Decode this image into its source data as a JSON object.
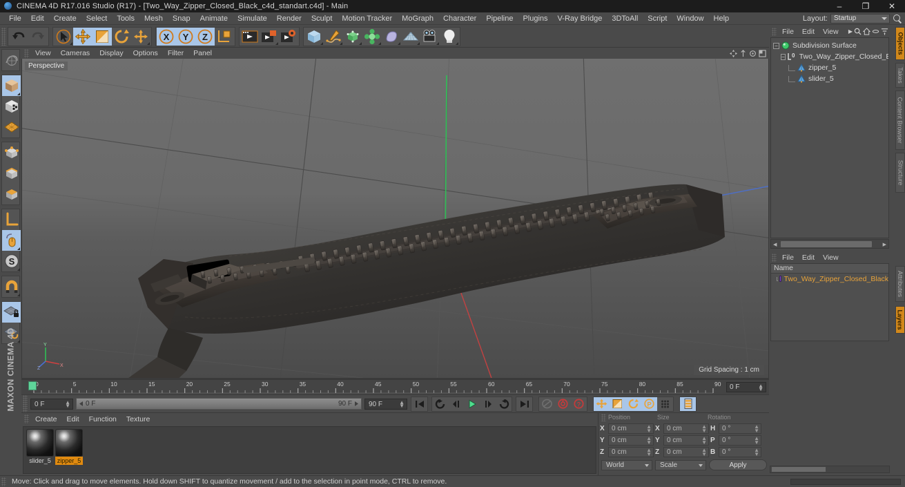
{
  "window": {
    "title": "CINEMA 4D R17.016 Studio (R17) - [Two_Way_Zipper_Closed_Black_c4d_standart.c4d] - Main",
    "minimize": "–",
    "maximize": "❐",
    "close": "✕"
  },
  "menubar": {
    "items": [
      "File",
      "Edit",
      "Create",
      "Select",
      "Tools",
      "Mesh",
      "Snap",
      "Animate",
      "Simulate",
      "Render",
      "Sculpt",
      "Motion Tracker",
      "MoGraph",
      "Character",
      "Pipeline",
      "Plugins",
      "V-Ray Bridge",
      "3DToAll",
      "Script",
      "Window",
      "Help"
    ],
    "layout_label": "Layout:",
    "layout_value": "Startup",
    "search_icon": "search-icon"
  },
  "toolbar": {
    "groups": [
      {
        "name": "history",
        "buttons": [
          {
            "icon": "undo-icon",
            "label": "Undo",
            "active": false
          },
          {
            "icon": "redo-icon",
            "label": "Redo",
            "active": false
          }
        ]
      },
      {
        "name": "selection-transform",
        "buttons": [
          {
            "icon": "live-selection-icon",
            "label": "Live Selection",
            "active": false
          },
          {
            "icon": "move-icon",
            "label": "Move",
            "active": true
          },
          {
            "icon": "scale-icon",
            "label": "Scale",
            "active": false
          },
          {
            "icon": "rotate-icon",
            "label": "Rotate",
            "active": false
          },
          {
            "icon": "move-alt-icon",
            "label": "Move (alt)",
            "active": false
          }
        ]
      },
      {
        "name": "axis-locks",
        "buttons": [
          {
            "icon": "axis-x-icon",
            "label": "X",
            "active": true
          },
          {
            "icon": "axis-y-icon",
            "label": "Y",
            "active": true
          },
          {
            "icon": "axis-z-icon",
            "label": "Z",
            "active": true
          },
          {
            "icon": "world-coordinate-icon",
            "label": "World/Object",
            "active": false
          }
        ]
      },
      {
        "name": "render",
        "buttons": [
          {
            "icon": "render-view-icon",
            "label": "Render View",
            "active": false
          },
          {
            "icon": "render-picture-viewer-icon",
            "label": "Render to Picture Viewer",
            "active": false
          },
          {
            "icon": "render-settings-icon",
            "label": "Edit Render Settings",
            "active": false
          }
        ]
      },
      {
        "name": "objects",
        "buttons": [
          {
            "icon": "cube-primitive-icon",
            "label": "Add Cube Object",
            "active": false
          },
          {
            "icon": "spline-pen-icon",
            "label": "Add Spline",
            "active": false
          },
          {
            "icon": "generator-nurbs-icon",
            "label": "Add NURBS Object",
            "active": false
          },
          {
            "icon": "mograph-cloner-icon",
            "label": "MoGraph",
            "active": false
          },
          {
            "icon": "deformer-icon",
            "label": "Add Deformer",
            "active": false
          },
          {
            "icon": "environment-floor-icon",
            "label": "Add Scene Object",
            "active": false
          },
          {
            "icon": "camera-icon",
            "label": "Add Camera",
            "active": false
          },
          {
            "icon": "light-icon",
            "label": "Add Light",
            "active": false
          }
        ]
      }
    ]
  },
  "leftbar": {
    "groups": [
      {
        "buttons": [
          {
            "icon": "make-editable-icon",
            "label": "Make Editable",
            "active": false
          }
        ]
      },
      {
        "buttons": [
          {
            "icon": "model-mode-icon",
            "label": "Model Mode",
            "active": true
          },
          {
            "icon": "texture-mode-icon",
            "label": "Texture Mode",
            "active": false
          },
          {
            "icon": "workplane-mode-icon",
            "label": "Workplane Mode",
            "active": false
          }
        ]
      },
      {
        "buttons": [
          {
            "icon": "points-mode-icon",
            "label": "Points Mode",
            "active": false
          },
          {
            "icon": "edges-mode-icon",
            "label": "Edges Mode",
            "active": false
          },
          {
            "icon": "polygons-mode-icon",
            "label": "Polygons Mode",
            "active": false
          }
        ]
      },
      {
        "buttons": [
          {
            "icon": "object-axis-icon",
            "label": "Enable Axis Modification",
            "active": false
          },
          {
            "icon": "viewport-solo-icon",
            "label": "Viewport Solo",
            "active": true
          },
          {
            "icon": "soft-selection-icon",
            "label": "Enable Soft Selection",
            "active": false
          }
        ]
      },
      {
        "buttons": [
          {
            "icon": "snap-magnet-icon",
            "label": "Enable Snapping",
            "active": false
          }
        ]
      },
      {
        "buttons": [
          {
            "icon": "workplane-lock-icon",
            "label": "Lock Workplane",
            "active": true
          },
          {
            "icon": "planar-workplane-icon",
            "label": "Planar Workplane",
            "active": false
          }
        ]
      }
    ],
    "brand": "MAXON CINEMA 4D"
  },
  "viewport": {
    "menu": [
      "View",
      "Cameras",
      "Display",
      "Options",
      "Filter",
      "Panel"
    ],
    "label": "Perspective",
    "grid_spacing": "Grid Spacing : 1 cm",
    "nav_icons": [
      "pan-icon",
      "zoom-icon",
      "rotate-view-icon",
      "maximize-view-icon"
    ],
    "axis": {
      "x": "X",
      "y": "Y",
      "z": "Z"
    }
  },
  "timeline": {
    "min": 0,
    "max": 90,
    "major_ticks": [
      0,
      5,
      10,
      15,
      20,
      25,
      30,
      35,
      40,
      45,
      50,
      55,
      60,
      65,
      70,
      75,
      80,
      85,
      90
    ],
    "current_frame_field": "0 F"
  },
  "playbar": {
    "current_frame": "0 F",
    "track_start": "0 F",
    "track_end": "90 F",
    "end_frame": "90 F",
    "transport": [
      {
        "icon": "go-to-start-icon",
        "label": "Go to Start",
        "active": false
      },
      {
        "icon": "play-reverse-loop-icon",
        "label": "Play Reverse",
        "active": false
      },
      {
        "icon": "step-back-icon",
        "label": "Previous Frame",
        "active": false
      },
      {
        "icon": "play-icon",
        "label": "Play Forwards",
        "active": false
      },
      {
        "icon": "step-forward-icon",
        "label": "Next Frame",
        "active": false
      },
      {
        "icon": "loop-icon",
        "label": "Play Loop",
        "active": false
      },
      {
        "icon": "go-to-end-icon",
        "label": "Go to End",
        "active": false
      }
    ],
    "record_group": [
      {
        "icon": "autokey-icon",
        "label": "Autokeying",
        "active": false
      },
      {
        "icon": "record-icon",
        "label": "Record Active Objects",
        "active": false
      },
      {
        "icon": "keyframe-selection-icon",
        "label": "Keyframe Selection",
        "active": false
      }
    ],
    "param_group": [
      {
        "icon": "position-key-icon",
        "label": "Position",
        "active": true
      },
      {
        "icon": "scale-key-icon",
        "label": "Scale",
        "active": true
      },
      {
        "icon": "rotation-key-icon",
        "label": "Rotation",
        "active": true
      },
      {
        "icon": "pla-key-icon",
        "label": "Point Level Animation",
        "active": true
      },
      {
        "icon": "parameter-key-icon",
        "label": "Parameter",
        "active": false
      }
    ],
    "extra_group": [
      {
        "icon": "timeline-toggle-icon",
        "label": "Animation Mode",
        "active": true
      }
    ]
  },
  "material_manager": {
    "menu": [
      "Create",
      "Edit",
      "Function",
      "Texture"
    ],
    "materials": [
      {
        "name": "slider_5",
        "selected": false
      },
      {
        "name": "zipper_5",
        "selected": true
      }
    ]
  },
  "coordinates": {
    "headers": [
      "Position",
      "Size",
      "Rotation"
    ],
    "rows": [
      {
        "pos_label": "X",
        "pos_value": "0 cm",
        "size_label": "X",
        "size_value": "0 cm",
        "rot_label": "H",
        "rot_value": "0 °"
      },
      {
        "pos_label": "Y",
        "pos_value": "0 cm",
        "size_label": "Y",
        "size_value": "0 cm",
        "rot_label": "P",
        "rot_value": "0 °"
      },
      {
        "pos_label": "Z",
        "pos_value": "0 cm",
        "size_label": "Z",
        "size_value": "0 cm",
        "rot_label": "B",
        "rot_value": "0 °"
      }
    ],
    "system": "World",
    "mode": "Scale",
    "apply": "Apply"
  },
  "object_manager": {
    "menu": [
      "File",
      "Edit",
      "View"
    ],
    "more_icon": "chevron-right-icon",
    "tool_icons": [
      "search-icon",
      "home-icon",
      "ellipse-icon",
      "filter-icon"
    ],
    "tree": [
      {
        "name": "Subdivision Surface",
        "depth": 0,
        "icon": "subdivision-surface-icon",
        "expander": "−"
      },
      {
        "name": "Two_Way_Zipper_Closed_Black",
        "depth": 1,
        "icon": "null-object-icon",
        "expander": "−"
      },
      {
        "name": "zipper_5",
        "depth": 2,
        "icon": "polygon-object-icon",
        "expander": ""
      },
      {
        "name": "slider_5",
        "depth": 2,
        "icon": "polygon-object-icon",
        "expander": ""
      }
    ]
  },
  "attribute_manager": {
    "menu": [
      "File",
      "Edit",
      "View"
    ],
    "column_header": "Name",
    "rows": [
      {
        "name": "Two_Way_Zipper_Closed_Black",
        "color": "#7a46c8"
      }
    ]
  },
  "vertical_tabs": [
    {
      "label": "Objects",
      "active": true
    },
    {
      "label": "Takes",
      "active": false
    },
    {
      "label": "Content Browser",
      "active": false
    },
    {
      "label": "Structure",
      "active": false
    },
    {
      "label": "Attributes",
      "active": false
    },
    {
      "label": "Layers",
      "active": true
    }
  ],
  "statusbar": {
    "text": "Move: Click and drag to move elements. Hold down SHIFT to quantize movement / add to the selection in point mode, CTRL to remove."
  },
  "colors": {
    "accent_orange": "#e08a10",
    "active_blue": "#a9c6e8",
    "panel_gray": "#4a4a4a",
    "axis_x": "#c0392b",
    "axis_y": "#27ae60",
    "axis_z": "#2f5fc0"
  }
}
